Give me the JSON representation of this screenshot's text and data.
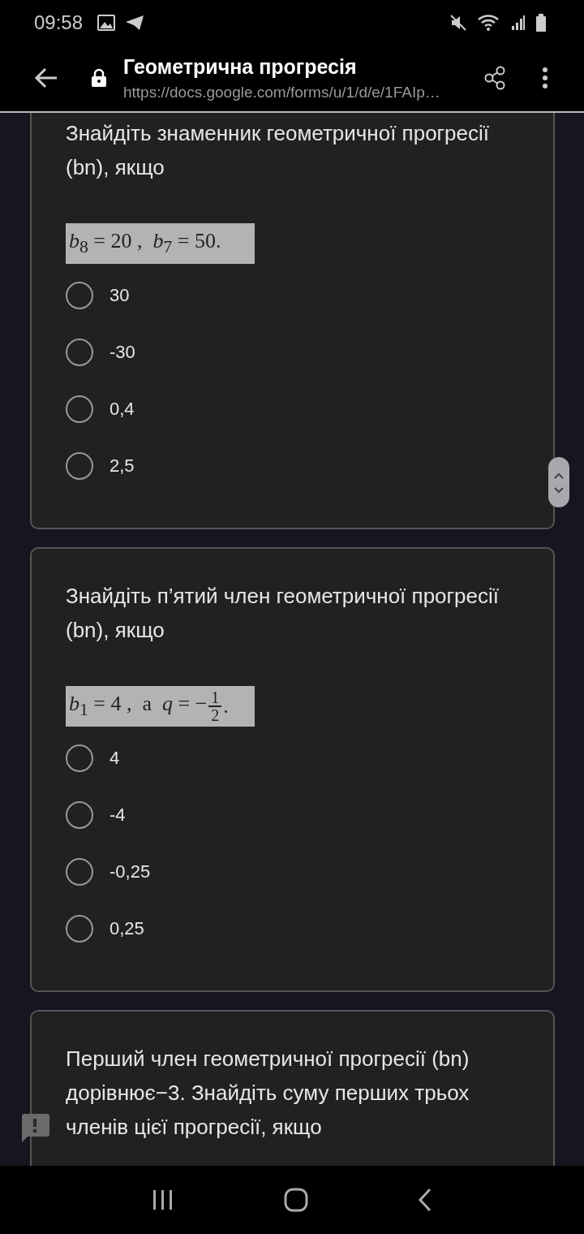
{
  "status_bar": {
    "time": "09:58"
  },
  "toolbar": {
    "title": "Геометрична прогресія",
    "url": "https://docs.google.com/forms/u/1/d/e/1FAIp…"
  },
  "questions": [
    {
      "text": "Знайдіть знаменник геометричної прогресії (bn), якщо",
      "formula": {
        "lead": "*b*$_{8}$ = 20 ,  *b*$_{7}$ = 50."
      },
      "options": [
        {
          "label": "30",
          "selected": false
        },
        {
          "label": "-30",
          "selected": false
        },
        {
          "label": "0,4",
          "selected": false
        },
        {
          "label": "2,5",
          "selected": false
        }
      ]
    },
    {
      "text": "Знайдіть п’ятий член геометричної прогресії (bn), якщо",
      "formula": {
        "lead": "*b*$_{1}$ = 4 ,  a  *q* = −",
        "numerator": "1",
        "denominator": "2",
        "tail": "."
      },
      "options": [
        {
          "label": "4",
          "selected": false
        },
        {
          "label": "-4",
          "selected": false
        },
        {
          "label": "-0,25",
          "selected": false
        },
        {
          "label": "0,25",
          "selected": false
        }
      ]
    },
    {
      "text": "Перший член геометричної прогресії (bn) дорівнює−3. Знайдіть суму перших трьох членів цієї прогресії, якщо"
    }
  ]
}
